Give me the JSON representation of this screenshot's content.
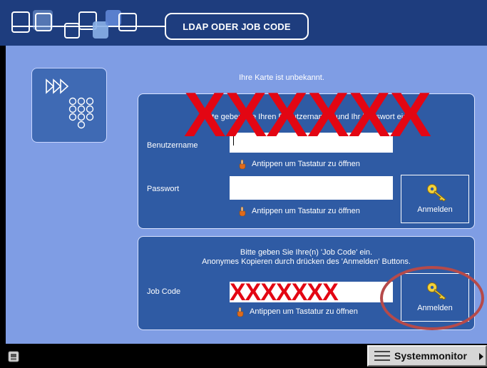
{
  "header": {
    "title": "LDAP ODER JOB CODE"
  },
  "main": {
    "info_text": "Ihre Karte ist unbekannt.",
    "mode_icon": "arrows-keypad-icon"
  },
  "ldap_panel": {
    "instruction": "Bitte geben Sie Ihren Benutzernamen und Ihr Passwort ein.",
    "username_label": "Benutzername",
    "username_value": "",
    "username_hint": "Antippen um Tastatur zu öffnen",
    "password_label": "Passwort",
    "password_value": "",
    "password_hint": "Antippen um Tastatur zu öffnen",
    "login_button": "Anmelden",
    "redaction_text": "XXXXXX"
  },
  "jobcode_panel": {
    "instruction_line1": "Bitte geben Sie Ihre(n) 'Job Code' ein.",
    "instruction_line2": "Anonymes Kopieren durch drücken des 'Anmelden' Buttons.",
    "jobcode_label": "Job Code",
    "jobcode_value": "XXXXXXX",
    "jobcode_hint": "Antippen um Tastatur zu öffnen",
    "login_button": "Anmelden"
  },
  "statusbar": {
    "system_monitor": "Systemmonitor",
    "left_icon": "printer-status-icon"
  },
  "colors": {
    "header_bg": "#1e3d7e",
    "main_bg": "#7f9de4",
    "panel_bg": "#2f5ba4",
    "redaction": "#e30613",
    "highlight_oval": "#b64a4a"
  }
}
